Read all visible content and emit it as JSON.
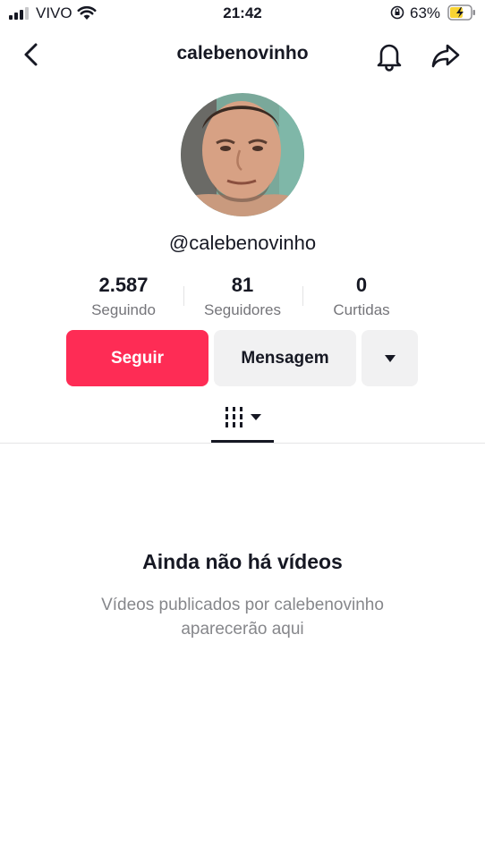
{
  "status_bar": {
    "carrier": "VIVO",
    "time": "21:42",
    "battery_percent": "63%",
    "battery_level": 0.63,
    "battery_color": "#f8d333"
  },
  "header": {
    "title": "calebenovinho",
    "back_icon": "chevron-left-icon",
    "bell_icon": "bell-icon",
    "share_icon": "share-arrow-icon"
  },
  "profile": {
    "handle": "@calebenovinho",
    "stats": [
      {
        "value": "2.587",
        "label": "Seguindo"
      },
      {
        "value": "81",
        "label": "Seguidores"
      },
      {
        "value": "0",
        "label": "Curtidas"
      }
    ]
  },
  "actions": {
    "follow_label": "Seguir",
    "message_label": "Mensagem",
    "follow_color": "#fe2c55"
  },
  "empty_state": {
    "title": "Ainda não há vídeos",
    "description": "Vídeos publicados por calebenovinho aparecerão aqui"
  }
}
